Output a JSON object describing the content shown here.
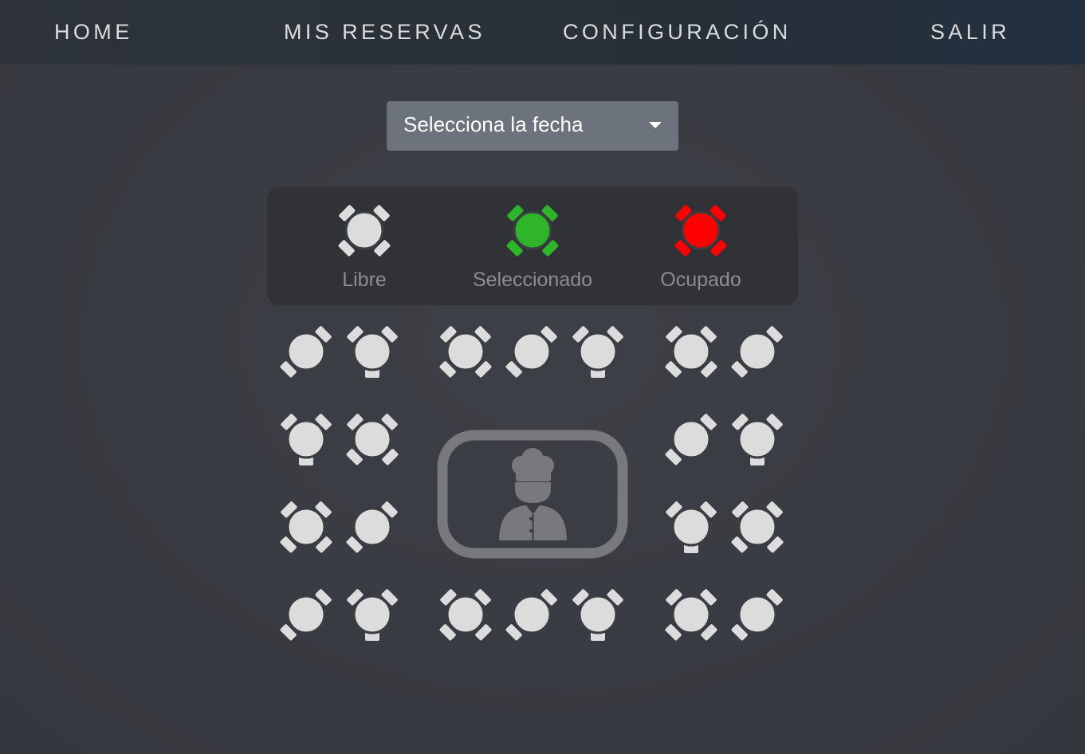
{
  "nav": {
    "home": "HOME",
    "reservations": "MIS RESERVAS",
    "settings": "CONFIGURACIÓN",
    "logout": "SALIR"
  },
  "date_select": {
    "placeholder": "Selecciona la fecha",
    "icon": "chevron-down-icon"
  },
  "legend": {
    "free": {
      "label": "Libre",
      "color": "#dcdcdc"
    },
    "selected": {
      "label": "Seleccionado",
      "color": "#2fb52a"
    },
    "occupied": {
      "label": "Ocupado",
      "color": "#ff0000"
    }
  },
  "tables": {
    "status": "free",
    "layouts": [
      "diagonal-2",
      "three-seat",
      "four-seat"
    ]
  },
  "kitchen": {
    "icon": "chef-icon"
  },
  "colors": {
    "free": "#dcdcdc",
    "selected": "#2fb52a",
    "occupied": "#ff0000",
    "navbar": "#2b3139",
    "select_bg": "#6c737d",
    "legend_bg": "#303236"
  }
}
